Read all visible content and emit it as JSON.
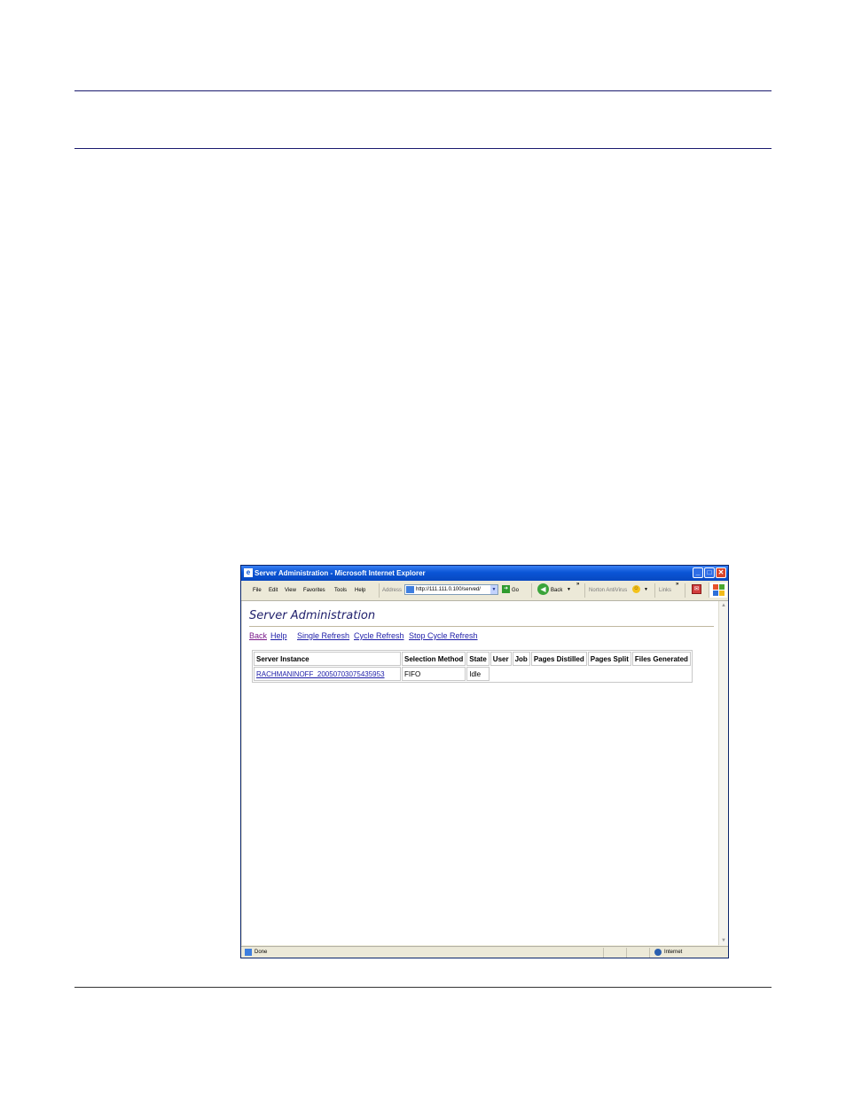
{
  "window": {
    "title": "Server Administration - Microsoft Internet Explorer",
    "minimize_glyph": "_",
    "maximize_glyph": "□",
    "close_glyph": "✕"
  },
  "menu": [
    "File",
    "Edit",
    "View",
    "Favorites",
    "Tools",
    "Help"
  ],
  "toolbar": {
    "address_label": "Address",
    "address_value": "http://111.111.0.100/served/",
    "go_label": "Go",
    "back_label": "Back",
    "norton_label": "Norton AntiVirus",
    "links_label": "Links",
    "chevron": "»"
  },
  "page": {
    "title": "Server Administration",
    "nav_links": [
      "Back",
      "Help",
      "Single Refresh",
      "Cycle Refresh",
      "Stop Cycle Refresh"
    ]
  },
  "table": {
    "headers": [
      "Server Instance",
      "Selection Method",
      "State",
      "User",
      "Job",
      "Pages Distilled",
      "Pages Split",
      "Files Generated"
    ],
    "rows": [
      {
        "instance": "RACHMANINOFF_20050703075435953",
        "method": "FIFO",
        "state": "Idle"
      }
    ]
  },
  "status": {
    "text": "Done",
    "zone": "Internet"
  },
  "colors": {
    "title_bar": "#0a55d6",
    "link": "#1d1da8",
    "visited_link": "#7a1a8a",
    "page_title": "#1f1f6b"
  }
}
